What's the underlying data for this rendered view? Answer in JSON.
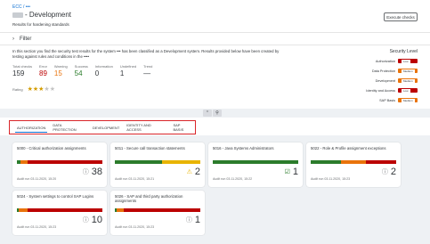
{
  "header": {
    "breadcrumb": "ECC / •••",
    "title": "- Development",
    "subtitle": "Results for hardening standards",
    "execute_label": "Execute checks"
  },
  "filter": {
    "label": "Filter"
  },
  "description": "In this section you find the security test results for the system ••• has been classified as a Development system. Results provided below have been created by testing against rules and conditions in the ••••",
  "kpis": [
    {
      "label": "Total checks",
      "value": "159",
      "color": "#32363a"
    },
    {
      "label": "Error",
      "value": "89",
      "color": "#bb0000"
    },
    {
      "label": "Warning",
      "value": "15",
      "color": "#e9730c"
    },
    {
      "label": "Success",
      "value": "54",
      "color": "#2b7c2b"
    },
    {
      "label": "Information",
      "value": "0",
      "color": "#32363a"
    },
    {
      "label": "Undefined",
      "value": "1",
      "color": "#32363a"
    },
    {
      "label": "Trend",
      "value": "—",
      "color": "#32363a"
    }
  ],
  "rating": {
    "label": "Rating",
    "stars": 2.5,
    "max": 5
  },
  "security_level": {
    "title": "Security Level",
    "items": [
      {
        "label": "Authorization",
        "level": "Low",
        "color": "#bb0000"
      },
      {
        "label": "Data Protection",
        "level": "Medium",
        "color": "#e9730c"
      },
      {
        "label": "Development",
        "level": "Medium",
        "color": "#e9730c"
      },
      {
        "label": "Identity and Access",
        "level": "Low",
        "color": "#bb0000"
      },
      {
        "label": "SAP Basis",
        "level": "Medium",
        "color": "#e9730c"
      }
    ]
  },
  "tabs": [
    {
      "label": "AUTHORIZATION",
      "active": true
    },
    {
      "label": "DATA PROTECTION",
      "active": false
    },
    {
      "label": "DEVELOPMENT",
      "active": false
    },
    {
      "label": "IDENTITY AND ACCESS",
      "active": false
    },
    {
      "label": "SAP BASIS",
      "active": false
    }
  ],
  "cards": [
    {
      "title": "5000 - Critical authorization assignments",
      "status_icon": "info-circle-icon",
      "icon_color": "#6a6d70",
      "count": "38",
      "audit": "Audit run 03.11.2020, 15:20",
      "bar": [
        [
          "g",
          4
        ],
        [
          "o",
          8
        ],
        [
          "r",
          88
        ]
      ]
    },
    {
      "title": "5011 - Secure call transaction statements",
      "status_icon": "warning-triangle-icon",
      "icon_color": "#e8b400",
      "count": "2",
      "audit": "Audit run 03.11.2020, 15:21",
      "bar": [
        [
          "g",
          55
        ],
        [
          "y",
          45
        ]
      ]
    },
    {
      "title": "5016 - Java Systems Administrators",
      "status_icon": "check-box-icon",
      "icon_color": "#2b7c2b",
      "count": "1",
      "audit": "Audit run 03.11.2020, 15:22",
      "bar": [
        [
          "g",
          100
        ]
      ]
    },
    {
      "title": "5022 - Role & Profile assignment exceptions",
      "status_icon": "info-circle-icon",
      "icon_color": "#6a6d70",
      "count": "2",
      "audit": "Audit run 03.11.2020, 15:23",
      "bar": [
        [
          "g",
          35
        ],
        [
          "o",
          30
        ],
        [
          "r",
          35
        ]
      ]
    },
    {
      "title": "5024 - System settings to control SAP Logins",
      "status_icon": "info-circle-icon",
      "icon_color": "#6a6d70",
      "count": "10",
      "audit": "Audit run 03.11.2020, 15:23",
      "bar": [
        [
          "g",
          2
        ],
        [
          "o",
          10
        ],
        [
          "r",
          88
        ]
      ]
    },
    {
      "title": "5026 - SAP and third party authorization assignments",
      "status_icon": "info-circle-icon",
      "icon_color": "#6a6d70",
      "count": "1",
      "audit": "Audit run 03.11.2020, 15:23",
      "bar": [
        [
          "g",
          2
        ],
        [
          "o",
          8
        ],
        [
          "r",
          90
        ]
      ]
    }
  ]
}
